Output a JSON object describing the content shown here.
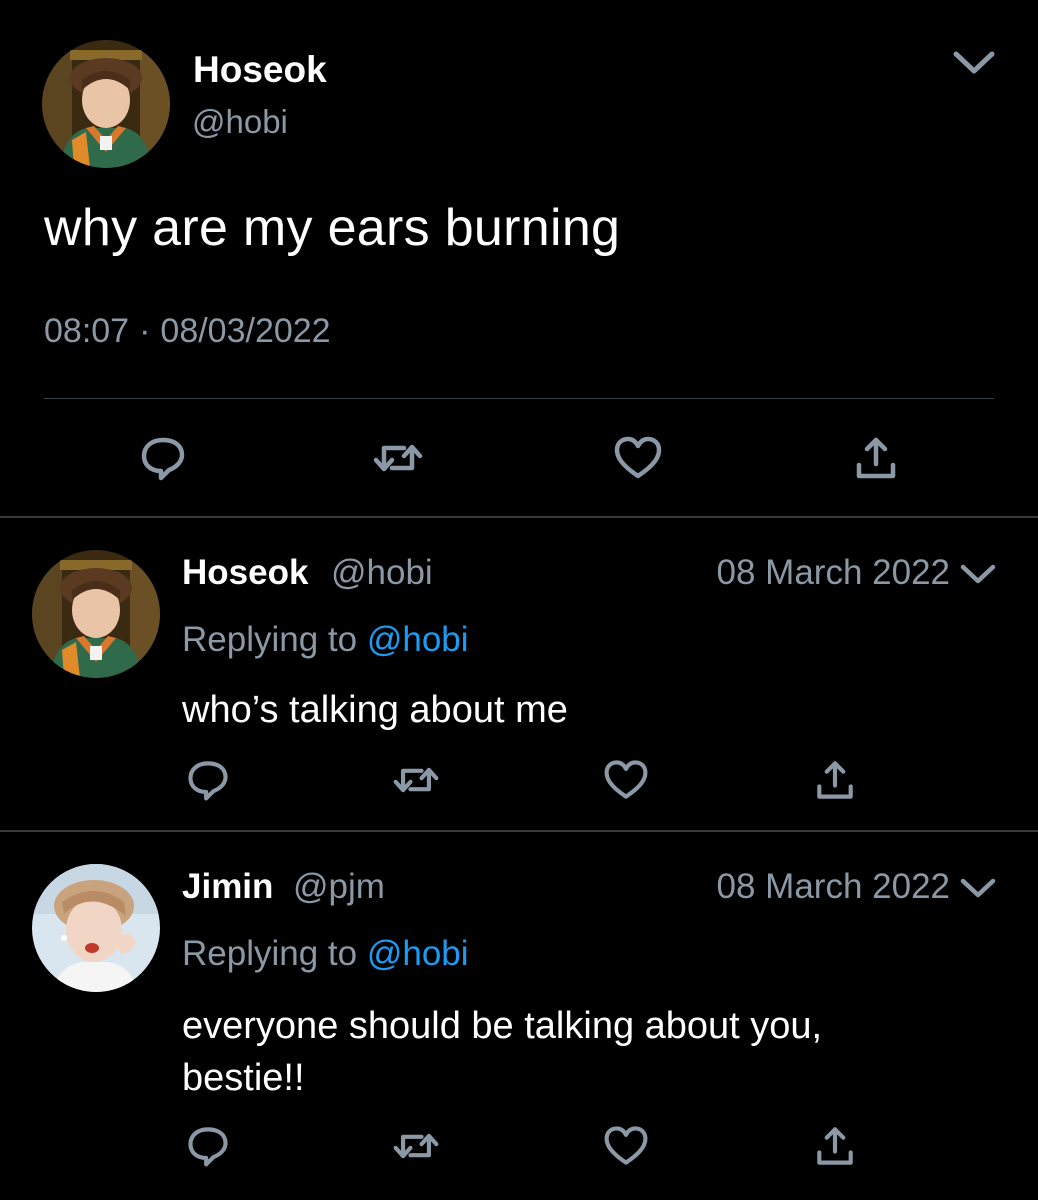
{
  "main_tweet": {
    "author_name": "Hoseok",
    "author_handle": "@hobi",
    "text": "why are my ears burning",
    "time": "08:07",
    "separator": "·",
    "date": "08/03/2022",
    "avatar_icon": "avatar-hoseok"
  },
  "replies": [
    {
      "author_name": "Hoseok",
      "author_handle": "@hobi",
      "date": "08 March 2022",
      "replying_prefix": "Replying to",
      "replying_to": "@hobi",
      "text": "who’s talking about me",
      "avatar_icon": "avatar-hoseok"
    },
    {
      "author_name": "Jimin",
      "author_handle": "@pjm",
      "date": "08 March 2022",
      "replying_prefix": "Replying to",
      "replying_to": "@hobi",
      "text": "everyone should be talking about you, bestie!!",
      "avatar_icon": "avatar-jimin"
    }
  ],
  "actions": [
    "reply-icon",
    "retweet-icon",
    "like-icon",
    "share-icon"
  ],
  "colors": {
    "background": "#000000",
    "primary_text": "#ffffff",
    "secondary_text": "#8b98a5",
    "accent": "#1d9bf0",
    "divider": "#38444d"
  }
}
